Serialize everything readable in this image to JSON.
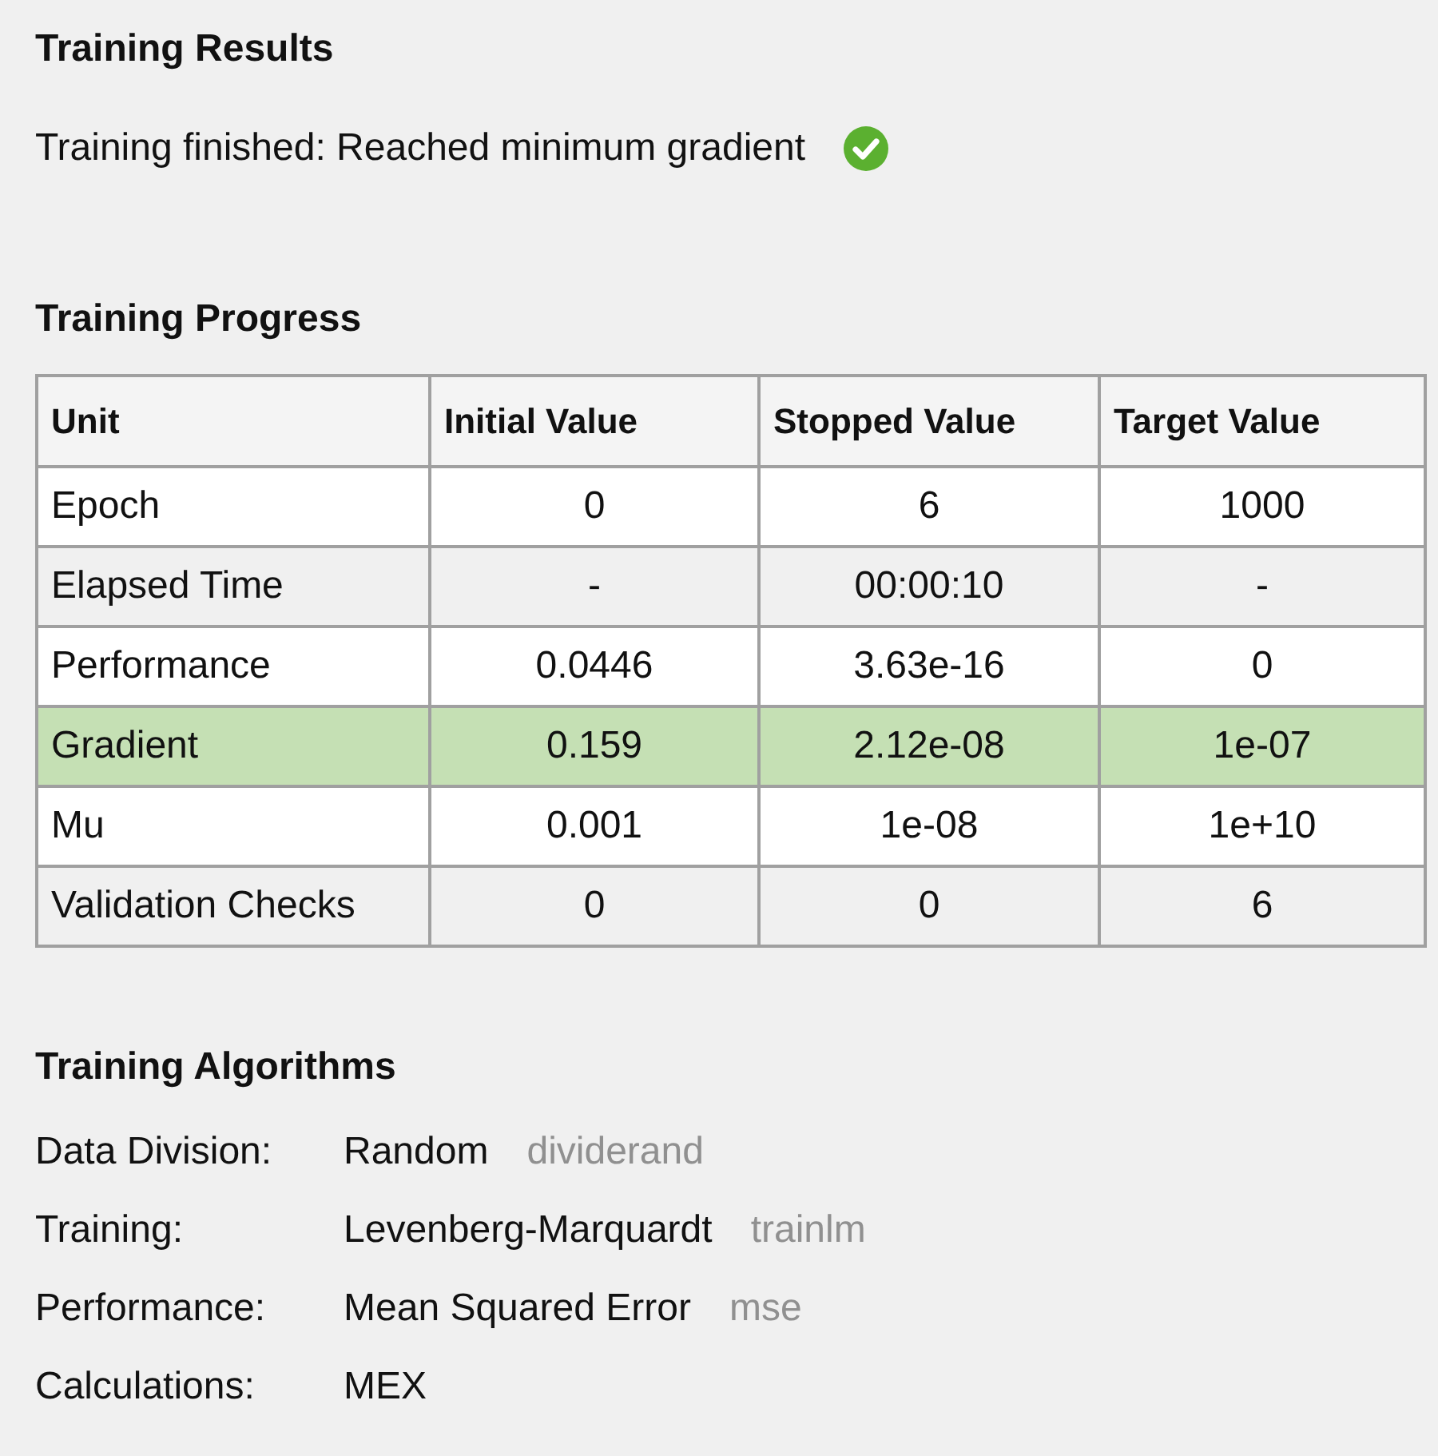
{
  "results": {
    "title": "Training Results",
    "status": "Training finished: Reached minimum gradient",
    "completed": true
  },
  "progress": {
    "title": "Training Progress",
    "columns": [
      "Unit",
      "Initial Value",
      "Stopped Value",
      "Target Value"
    ],
    "rows": [
      {
        "cells": [
          "Epoch",
          "0",
          "6",
          "1000"
        ],
        "highlighted": false
      },
      {
        "cells": [
          "Elapsed Time",
          "-",
          "00:00:10",
          "-"
        ],
        "highlighted": false
      },
      {
        "cells": [
          "Performance",
          "0.0446",
          "3.63e-16",
          "0"
        ],
        "highlighted": false
      },
      {
        "cells": [
          "Gradient",
          "0.159",
          "2.12e-08",
          "1e-07"
        ],
        "highlighted": true
      },
      {
        "cells": [
          "Mu",
          "0.001",
          "1e-08",
          "1e+10"
        ],
        "highlighted": false
      },
      {
        "cells": [
          "Validation Checks",
          "0",
          "0",
          "6"
        ],
        "highlighted": false
      }
    ]
  },
  "algorithms": {
    "title": "Training Algorithms",
    "items": [
      {
        "label": "Data Division:",
        "value": "Random",
        "function": "dividerand"
      },
      {
        "label": "Training:",
        "value": "Levenberg-Marquardt",
        "function": "trainlm"
      },
      {
        "label": "Performance:",
        "value": "Mean Squared Error",
        "function": "mse"
      },
      {
        "label": "Calculations:",
        "value": "MEX"
      }
    ]
  }
}
